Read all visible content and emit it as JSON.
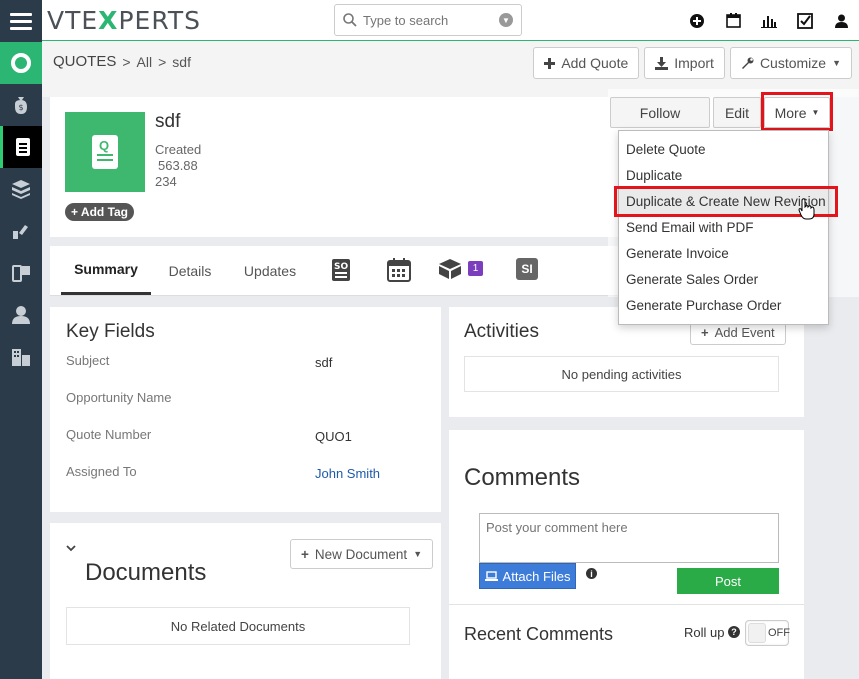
{
  "app": {
    "logo_part1": "VTE",
    "logo_x": "X",
    "logo_part2": "PERTS"
  },
  "search": {
    "placeholder": "Type to search"
  },
  "breadcrumb": {
    "module": "QUOTES",
    "sep1": ">",
    "filter": "All",
    "sep2": ">",
    "record": "sdf"
  },
  "toolbar": {
    "add_quote": "Add Quote",
    "import": "Import",
    "customize": "Customize"
  },
  "record": {
    "title": "sdf",
    "meta": [
      "Created",
      "563.88",
      "234"
    ],
    "add_tag": "Add Tag",
    "icon_letter": "Q"
  },
  "actions": {
    "follow": "Follow",
    "edit": "Edit",
    "more": "More"
  },
  "more_menu": [
    "Delete Quote",
    "Duplicate",
    "Duplicate & Create New Revision",
    "Send Email with PDF",
    "Generate Invoice",
    "Generate Sales Order",
    "Generate Purchase Order"
  ],
  "tabs": {
    "summary": "Summary",
    "details": "Details",
    "updates": "Updates",
    "so_icon": "SO",
    "badge_count": "1",
    "si_icon": "SI"
  },
  "key_fields": {
    "title": "Key Fields",
    "rows": [
      {
        "label": "Subject",
        "value": "sdf"
      },
      {
        "label": "Opportunity Name",
        "value": ""
      },
      {
        "label": "Quote Number",
        "value": "QUO1"
      },
      {
        "label": "Assigned To",
        "value": "John Smith"
      }
    ]
  },
  "documents": {
    "title": "Documents",
    "new_button": "New Document",
    "empty": "No Related Documents"
  },
  "activities": {
    "title": "Activities",
    "add_event": "Add Event",
    "empty": "No pending activities"
  },
  "comments": {
    "title": "Comments",
    "placeholder": "Post your comment here",
    "attach": "Attach Files",
    "post": "Post",
    "recent": "Recent Comments",
    "rollup": "Roll up",
    "toggle": "OFF"
  },
  "colors": {
    "accent": "#2bb673",
    "highlight": "#e3141c",
    "sidebar": "#2c3b49",
    "post": "#2bab48",
    "attach": "#3d7cd9"
  }
}
